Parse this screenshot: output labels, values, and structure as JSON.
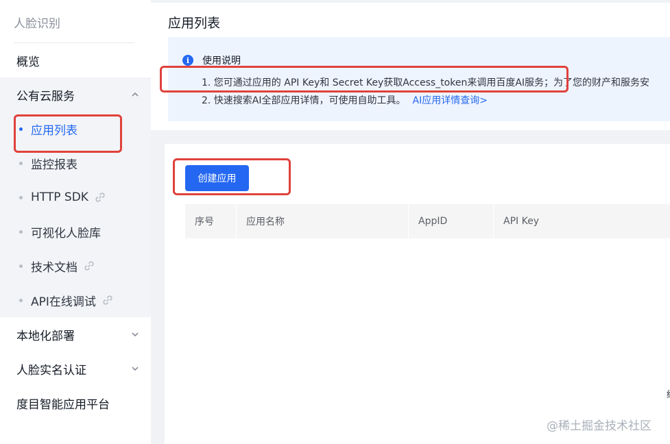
{
  "sidebar": {
    "product": "人脸识别",
    "overview": "概览",
    "group": {
      "label": "公有云服务",
      "items": [
        {
          "label": "应用列表",
          "active": true,
          "external_link": false
        },
        {
          "label": "监控报表",
          "active": false,
          "external_link": false
        },
        {
          "label": "HTTP SDK",
          "active": false,
          "external_link": true
        },
        {
          "label": "可视化人脸库",
          "active": false,
          "external_link": false
        },
        {
          "label": "技术文档",
          "active": false,
          "external_link": true
        },
        {
          "label": "API在线调试",
          "active": false,
          "external_link": true
        }
      ]
    },
    "bottom_items": [
      {
        "label": "本地化部署",
        "expandable": true
      },
      {
        "label": "人脸实名认证",
        "expandable": true
      },
      {
        "label": "度目智能应用平台",
        "expandable": false
      }
    ]
  },
  "page": {
    "title": "应用列表",
    "notice": {
      "title": "使用说明",
      "line1": "1. 您可通过应用的 API Key和 Secret Key获取Access_token来调用百度AI服务；为了您的财产和服务安",
      "line2": "2. 快速搜索AI全部应用详情，可使用自助工具。",
      "line2_link": "AI应用详情查询>"
    },
    "create_button": "创建应用",
    "table_headers": [
      "序号",
      "应用名称",
      "AppID",
      "API Key"
    ],
    "edge_fragment": "结"
  },
  "watermark": "@稀土掘金技术社区",
  "colors": {
    "accent": "#2468f2",
    "annotation": "#e0413b",
    "notice_bg": "#eef4fe",
    "sidebar_group_bg": "#f2f4f7"
  },
  "icons": {
    "info": "info-icon",
    "external_link": "link-icon",
    "chevron_up": "chevron-up-icon",
    "chevron_down": "chevron-down-icon"
  }
}
